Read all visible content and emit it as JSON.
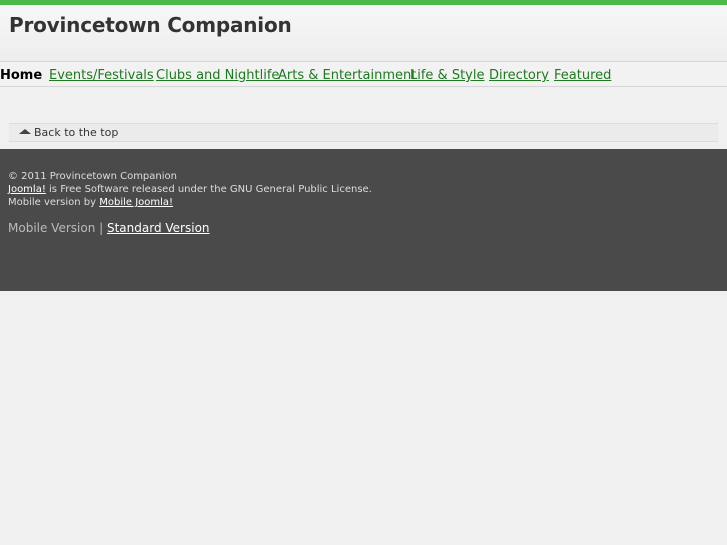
{
  "site": {
    "title": "Provincetown Companion"
  },
  "nav": {
    "items": [
      {
        "label": "Home",
        "current": true
      },
      {
        "label": "Events/Festivals"
      },
      {
        "label": "Clubs and Nightlife"
      },
      {
        "label": "Arts & Entertainment"
      },
      {
        "label": "Life & Style"
      },
      {
        "label": "Directory"
      },
      {
        "label": "Featured"
      }
    ]
  },
  "backtop": {
    "label": "Back to the top"
  },
  "footer": {
    "copyright": "© 2011 Provincetown Companion",
    "joomla_link": "Joomla!",
    "joomla_text": " is Free Software released under the GNU General Public License.",
    "mobile_prefix": "Mobile version by ",
    "mobile_link": "Mobile Joomla!",
    "version_current": "Mobile Version",
    "version_sep": " | ",
    "version_standard": "Standard Version"
  },
  "colors": {
    "accent": "#4cb848",
    "nav_link": "#1d7a1d",
    "footer_bg": "#4a4a4a"
  }
}
